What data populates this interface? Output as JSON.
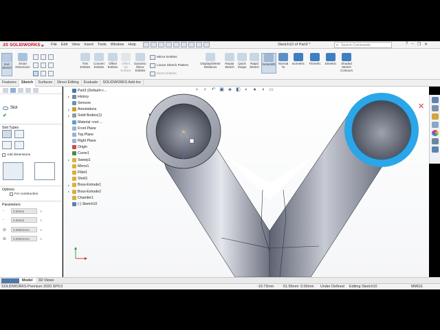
{
  "app": {
    "brand": "SOLIDWORKS",
    "brand_prefix": "3S",
    "menu": [
      "File",
      "Edit",
      "View",
      "Insert",
      "Tools",
      "Window",
      "Help"
    ],
    "document_title": "Sketch10 of Part3 *",
    "search_placeholder": "Search Commands"
  },
  "ribbon": {
    "exit_sketch": "Exit Sketch",
    "smart_dimension": "Smart Dimension",
    "trim_entities": "Trim Entities",
    "convert_entities": "Convert Entities",
    "offset_entities": "Offset Entities",
    "offset_on_surface": "Offset On Surface",
    "dynamic_mirror": "Dynamic Mirror Entities",
    "mirror_entities": "Mirror Entities",
    "linear_pattern": "Linear Sketch Pattern",
    "move_entities": "Move Entities",
    "display_delete_relations": "Display/Delete Relations",
    "repair_sketch": "Repair Sketch",
    "quick_snaps": "Quick Snaps",
    "rapid_sketch": "Rapid Sketch",
    "instant2d": "Instant2D",
    "normal_to": "Normal To",
    "isometric": "Isometric",
    "trimetric": "Trimetric",
    "dimetric": "Dimetric",
    "shaded_contours": "Shaded Sketch Contours"
  },
  "tabs": [
    "Features",
    "Sketch",
    "Surfaces",
    "Direct Editing",
    "Evaluate",
    "SOLIDWORKS Add-Ins"
  ],
  "property_manager": {
    "title": "Slot",
    "slot_types_label": "Slot Types",
    "add_dimensions": "Add dimensions",
    "options_label": "Options",
    "for_construction": "For construction",
    "parameters_label": "Parameters",
    "params": [
      "0.00mm",
      "0.00mm",
      "0.00001mm",
      "0.00001mm"
    ]
  },
  "tree": [
    {
      "label": "Part3  (Default<<...",
      "icon": "part-icon",
      "color": "#4a78b0",
      "exp": ""
    },
    {
      "label": "History",
      "icon": "history-icon",
      "color": "#7a8a9a",
      "exp": "▸"
    },
    {
      "label": "Sensors",
      "icon": "sensor-icon",
      "color": "#6b8fb8",
      "exp": ""
    },
    {
      "label": "Annotations",
      "icon": "annotation-icon",
      "color": "#d09a2a",
      "exp": "▸"
    },
    {
      "label": "Solid Bodies(1)",
      "icon": "body-icon",
      "color": "#8a9aa8",
      "exp": "▸"
    },
    {
      "label": "Material <not ...",
      "icon": "material-icon",
      "color": "#5e9fd4",
      "exp": ""
    },
    {
      "label": "Front Plane",
      "icon": "plane-icon",
      "color": "#9bb4cf",
      "exp": ""
    },
    {
      "label": "Top Plane",
      "icon": "plane-icon",
      "color": "#9bb4cf",
      "exp": ""
    },
    {
      "label": "Right Plane",
      "icon": "plane-icon",
      "color": "#9bb4cf",
      "exp": ""
    },
    {
      "label": "Origin",
      "icon": "origin-icon",
      "color": "#c84a4a",
      "exp": ""
    },
    {
      "label": "Curve1",
      "icon": "curve-icon",
      "color": "#4a8a4a",
      "exp": ""
    },
    {
      "label": "Sweep1",
      "icon": "sweep-icon",
      "color": "#d9b03a",
      "exp": "▸"
    },
    {
      "label": "Mirror1",
      "icon": "mirror-icon",
      "color": "#d9b03a",
      "exp": ""
    },
    {
      "label": "Fillet1",
      "icon": "fillet-icon",
      "color": "#d9b03a",
      "exp": ""
    },
    {
      "label": "Shell1",
      "icon": "shell-icon",
      "color": "#d9b03a",
      "exp": ""
    },
    {
      "label": "Boss-Extrude1",
      "icon": "extrude-icon",
      "color": "#d9b03a",
      "exp": "▸"
    },
    {
      "label": "Boss-Extrude2",
      "icon": "extrude-icon",
      "color": "#d9b03a",
      "exp": "▸"
    },
    {
      "label": "Chamfer1",
      "icon": "chamfer-icon",
      "color": "#d9b03a",
      "exp": ""
    },
    {
      "label": "(-) Sketch10",
      "icon": "sketch-icon",
      "color": "#5b84b0",
      "exp": ""
    }
  ],
  "bottom_tabs": [
    "Model",
    "3D Views"
  ],
  "status": {
    "product": "SOLIDWORKS Premium 2020 SP0.0",
    "x": "-19.73mm",
    "y": "61.56mm",
    "z": "0.00mm",
    "state": "Under Defined",
    "editing": "Editing Sketch10",
    "units": "MMGS"
  },
  "colors": {
    "highlight_ring": "#2ba6e8",
    "accent_red": "#c8102e"
  }
}
